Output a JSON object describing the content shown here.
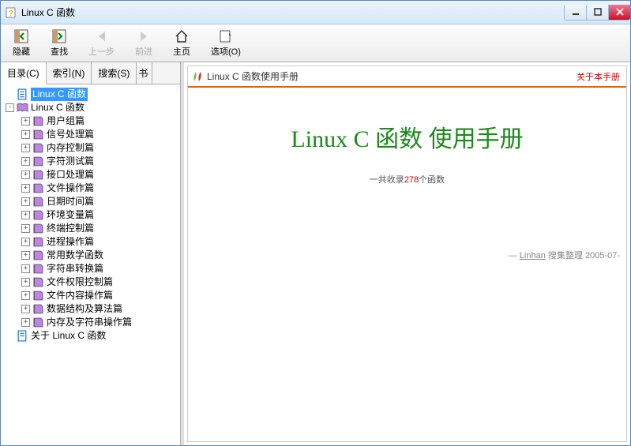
{
  "window": {
    "title": "Linux C 函数"
  },
  "toolbar": {
    "hide": "隐藏",
    "find": "查找",
    "back": "上一步",
    "forward": "前进",
    "home": "主页",
    "options": "选项(O)"
  },
  "tabs": {
    "toc": "目录(C)",
    "index": "索引(N)",
    "search": "搜索(S)",
    "fav": "书"
  },
  "tree": {
    "root_sel": "Linux C 函数",
    "root2": "Linux C 函数",
    "items": [
      "用户组篇",
      "信号处理篇",
      "内存控制篇",
      "字符测试篇",
      "接口处理篇",
      "文件操作篇",
      "日期时间篇",
      "环境变量篇",
      "终端控制篇",
      "进程操作篇",
      "常用数学函数",
      "字符串转换篇",
      "文件权限控制篇",
      "文件内容操作篇",
      "数据结构及算法篇",
      "内存及字符串操作篇"
    ],
    "about": "关于 Linux C 函数"
  },
  "content": {
    "header_title": "Linux C 函数使用手册",
    "header_link": "关于本手册",
    "main_title": "Linux C 函数 使用手册",
    "count_prefix": "一共收录",
    "count_num": "278",
    "count_suffix": "个函数",
    "footer_by": "— ",
    "footer_author": "Linhan",
    "footer_rest": " 搜集整理  2005-07-"
  }
}
